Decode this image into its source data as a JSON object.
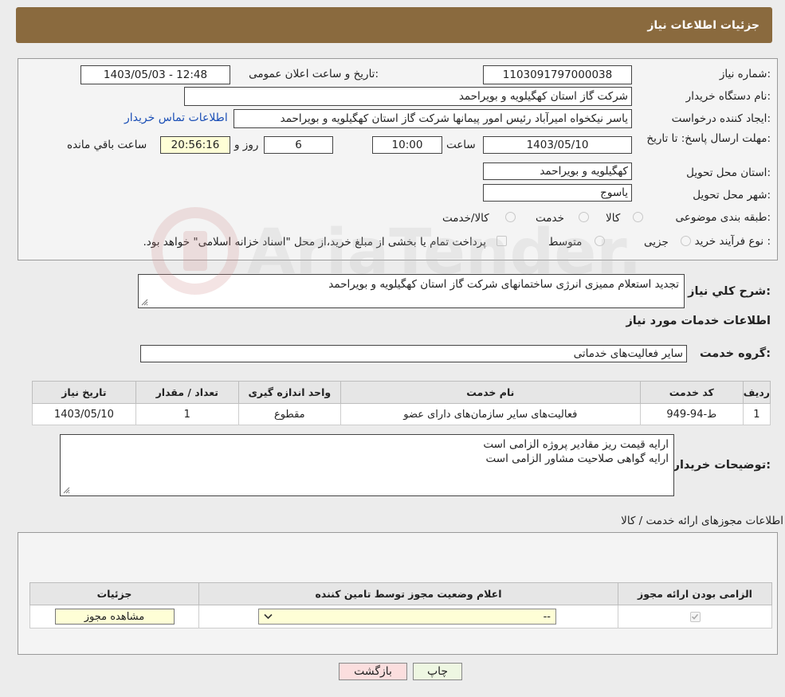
{
  "header": {
    "title": "جزئیات اطلاعات نیاز"
  },
  "form": {
    "need_number_label": "شماره نیاز:",
    "need_number": "1103091797000038",
    "announce_label": "تاریخ و ساعت اعلان عمومی:",
    "announce_value": "1403/05/03 - 12:48",
    "buyer_org_label": "نام دستگاه خریدار:",
    "buyer_org": "شرکت گاز استان کهگیلویه و بویراحمد",
    "creator_label": "ایجاد کننده درخواست:",
    "creator": "یاسر نیکخواه امیرآباد رئیس امور پیمانها شرکت گاز استان کهگیلویه و بویراحمد",
    "contact_link": "اطلاعات تماس خریدار",
    "deadline_label": "مهلت ارسال پاسخ: تا تاریخ:",
    "deadline_date": "1403/05/10",
    "time_label": "ساعت",
    "deadline_time": "10:00",
    "days": "6",
    "days_label": "روز و",
    "remaining_time": "20:56:16",
    "remaining_label": "ساعت باقي مانده",
    "province_label": "استان محل تحویل:",
    "province": "کهگیلویه و بویراحمد",
    "city_label": "شهر محل تحویل:",
    "city": "یاسوج",
    "category_label": "طبقه بندی موضوعی:",
    "category_options": [
      "کالا",
      "خدمت",
      "کالا/خدمت"
    ],
    "purchase_type_label": "نوع فرآیند خرید :",
    "purchase_options": [
      "جزیی",
      "متوسط"
    ],
    "payment_note": "پرداخت تمام یا بخشی از مبلغ خرید،از محل \"اسناد خزانه اسلامی\" خواهد بود."
  },
  "summary": {
    "label": "شرح کلي نياز:",
    "text": "تجدید استعلام ممیزی انرژی ساختمانهای شرکت گاز استان کهگیلویه و بویراحمد"
  },
  "services": {
    "section_title": "اطلاعات خدمات مورد نیاز",
    "group_label": "گروه خدمت:",
    "group_value": "سایر فعالیت‌های خدماتی",
    "columns": [
      "ردیف",
      "کد خدمت",
      "نام خدمت",
      "واحد اندازه گیری",
      "تعداد / مقدار",
      "تاریخ نیاز"
    ],
    "rows": [
      [
        "1",
        "ط-94-949",
        "فعالیت‌های سایر سازمان‌های دارای عضو",
        "مقطوع",
        "1",
        "1403/05/10"
      ]
    ]
  },
  "buyer_notes": {
    "label": "توضیحات خریدار:",
    "line1": "ارایه قیمت ریز مقادیر پروژه الزامی است",
    "line2": "ارایه گواهی صلاحیت مشاور الزامی است"
  },
  "permits": {
    "section_title": "اطلاعات مجوزهای ارائه خدمت / کالا",
    "columns": [
      "الزامی بودن ارائه مجوز",
      "اعلام وضعیت مجوز توسط تامین کننده",
      "جزئیات"
    ],
    "select_value": "--",
    "view_button": "مشاهده مجوز"
  },
  "footer": {
    "print_button": "چاپ",
    "back_button": "بازگشت"
  },
  "watermark": "AriaTender.neT"
}
